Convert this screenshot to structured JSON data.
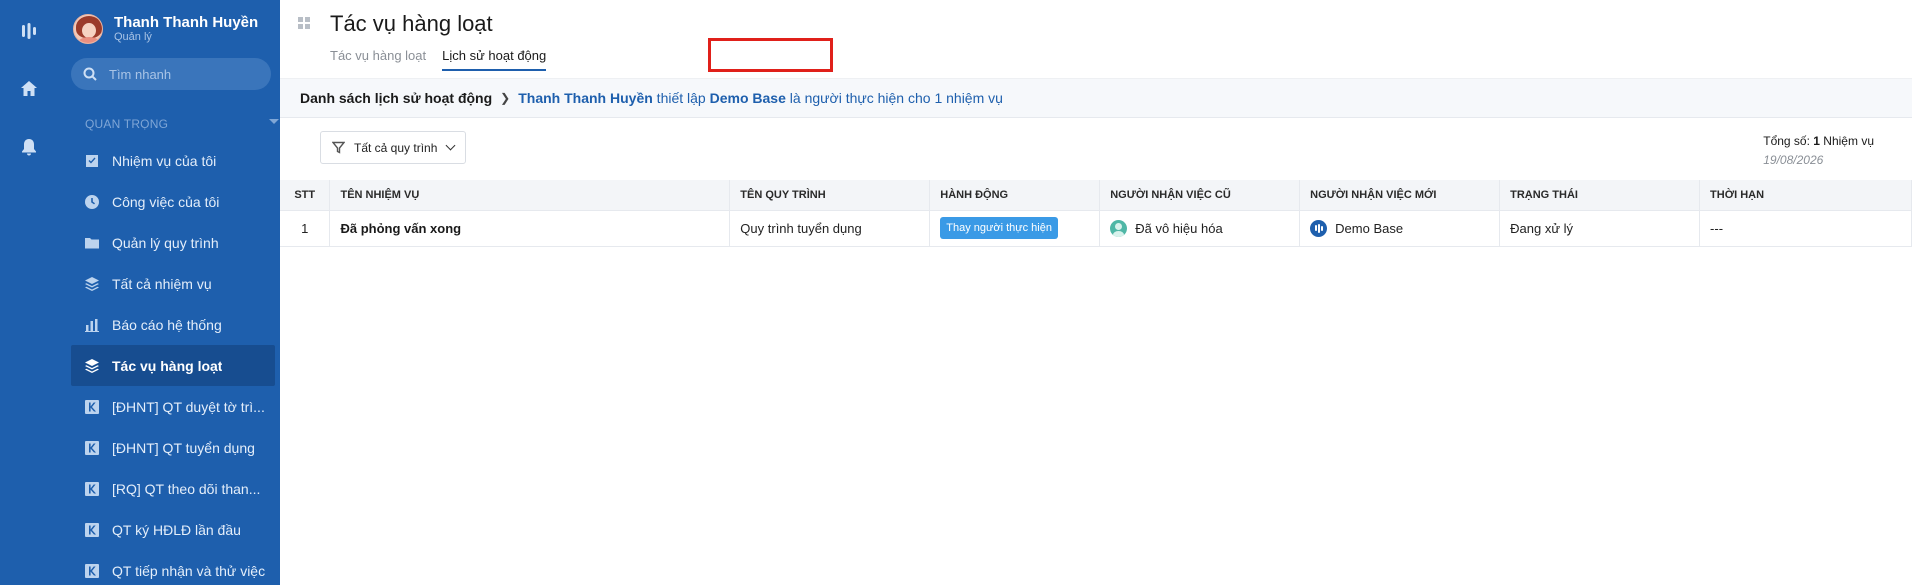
{
  "profile": {
    "name": "Thanh Thanh Huyền",
    "role": "Quản lý"
  },
  "search": {
    "placeholder": "Tìm nhanh"
  },
  "sidebar": {
    "section_label": "QUAN TRỌNG",
    "items": [
      {
        "label": "Nhiệm vụ của tôi",
        "icon": "checkbox-icon"
      },
      {
        "label": "Công việc của tôi",
        "icon": "clock-icon"
      },
      {
        "label": "Quản lý quy trình",
        "icon": "folder-icon"
      },
      {
        "label": "Tất cả nhiệm vụ",
        "icon": "layers-icon"
      },
      {
        "label": "Báo cáo hệ thống",
        "icon": "bar-chart-icon"
      },
      {
        "label": "Tác vụ hàng loạt",
        "icon": "layers-icon",
        "active": true
      },
      {
        "label": "[ĐHNT] QT duyệt tờ trì...",
        "icon": "workflow-icon"
      },
      {
        "label": "[ĐHNT] QT tuyển dụng",
        "icon": "workflow-icon"
      },
      {
        "label": "[RQ] QT theo dõi than...",
        "icon": "workflow-icon"
      },
      {
        "label": "QT ký HĐLĐ lần đầu",
        "icon": "workflow-icon"
      },
      {
        "label": "QT tiếp nhận và thử việc",
        "icon": "workflow-icon"
      }
    ]
  },
  "header": {
    "title": "Tác vụ hàng loạt",
    "tabs": [
      {
        "label": "Tác vụ hàng loạt",
        "active": false
      },
      {
        "label": "Lịch sử hoạt động",
        "active": true
      }
    ]
  },
  "breadcrumb": {
    "root": "Danh sách lịch sử hoạt động",
    "actor": "Thanh Thanh Huyền",
    "text1": " thiết lập ",
    "target": "Demo Base",
    "text2": " là người thực hiện cho 1 nhiệm vụ"
  },
  "filter": {
    "label": "Tất cả quy trình"
  },
  "summary": {
    "total_prefix": "Tổng số: ",
    "total_count": "1",
    "total_suffix": " Nhiệm vụ",
    "date": "19/08/2026"
  },
  "table": {
    "columns": [
      "STT",
      "TÊN NHIỆM VỤ",
      "TÊN QUY TRÌNH",
      "HÀNH ĐỘNG",
      "NGƯỜI NHẬN VIỆC CŨ",
      "NGƯỜI NHẬN VIỆC MỚI",
      "TRẠNG THÁI",
      "THỜI HẠN"
    ],
    "rows": [
      {
        "stt": "1",
        "task": "Đã phỏng vấn xong",
        "process": "Quy trình tuyển dụng",
        "action": "Thay người thực hiện",
        "old_assignee": "Đã vô hiệu hóa",
        "new_assignee": "Demo Base",
        "status": "Đang xử lý",
        "deadline": "---"
      }
    ]
  },
  "colors": {
    "sidebar": "#1e5fad",
    "accent": "#1e5fad",
    "badge": "#3a9ae6",
    "highlight": "#e0201a"
  }
}
